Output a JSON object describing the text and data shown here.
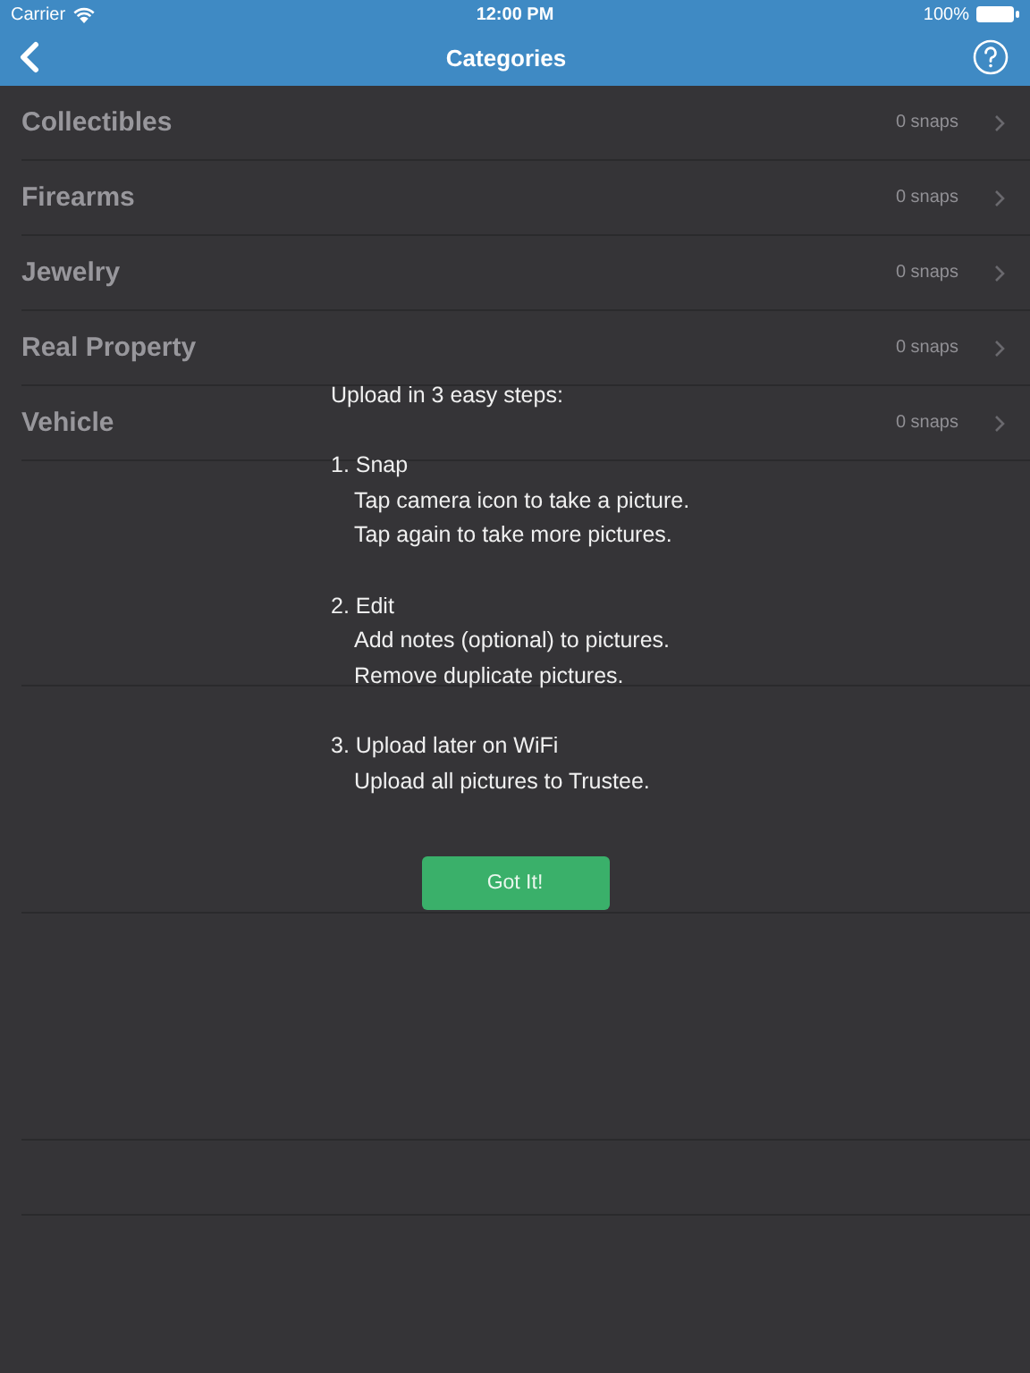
{
  "status_bar": {
    "carrier": "Carrier",
    "time": "12:00 PM",
    "battery": "100%"
  },
  "nav": {
    "title": "Categories"
  },
  "categories": [
    {
      "name": "Collectibles",
      "count": "0 snaps"
    },
    {
      "name": "Firearms",
      "count": "0 snaps"
    },
    {
      "name": "Jewelry",
      "count": "0 snaps"
    },
    {
      "name": "Real Property",
      "count": "0 snaps"
    },
    {
      "name": "Vehicle",
      "count": "0 snaps"
    }
  ],
  "instructions": {
    "heading": "Upload in 3 easy steps:",
    "steps": [
      {
        "title": "1. Snap",
        "lines": [
          "Tap camera icon to take a picture.",
          "Tap again to take more pictures."
        ]
      },
      {
        "title": "2. Edit",
        "lines": [
          "Add notes (optional) to pictures.",
          "Remove duplicate pictures."
        ]
      },
      {
        "title": "3. Upload later on WiFi",
        "lines": [
          "Upload all pictures to Trustee."
        ]
      }
    ],
    "button": "Got It!"
  }
}
